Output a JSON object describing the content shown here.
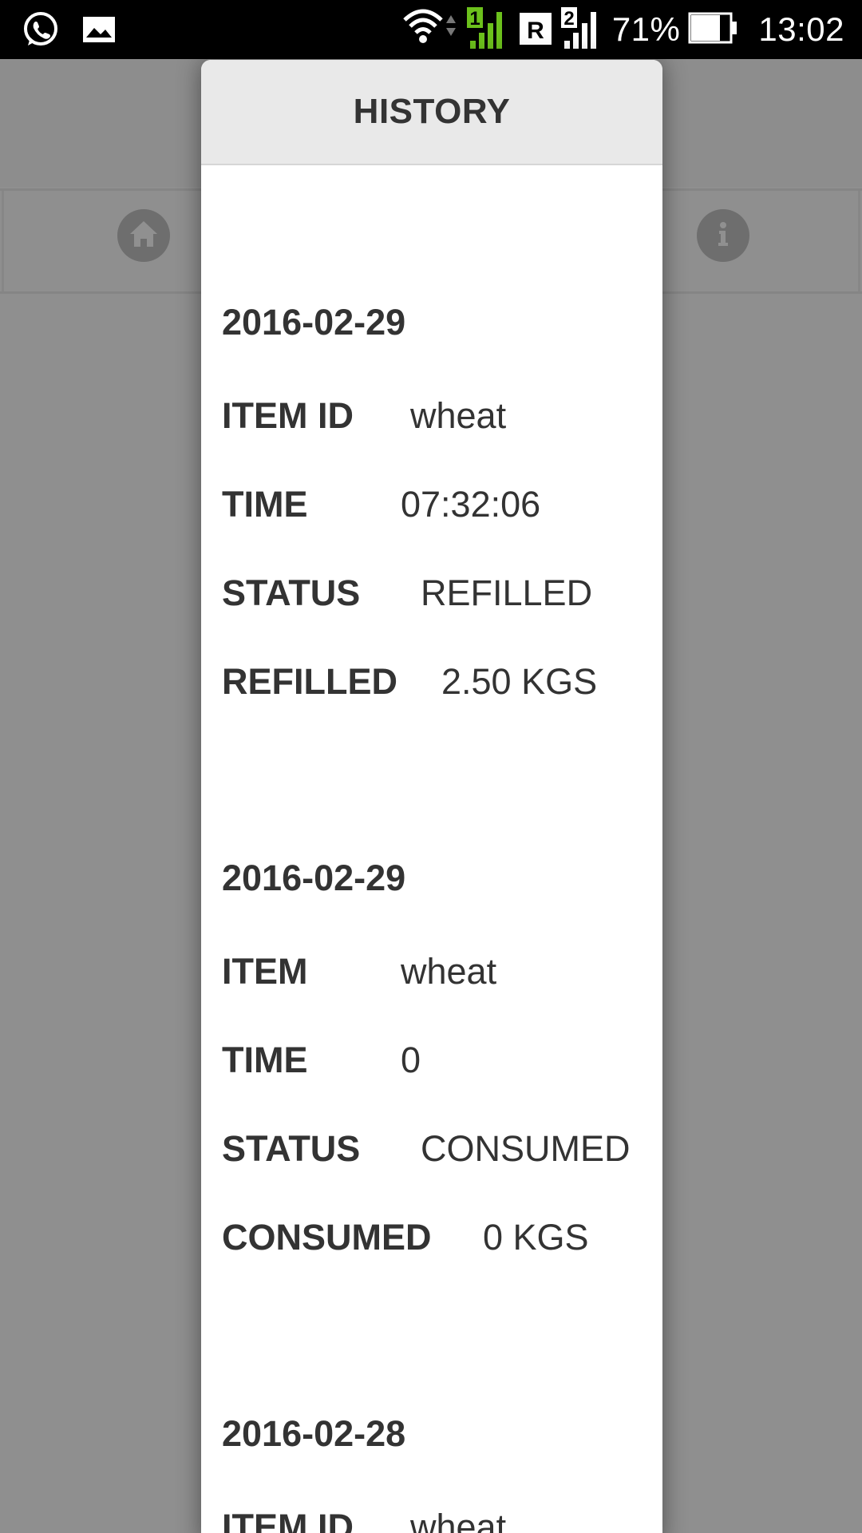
{
  "status_bar": {
    "battery_percent": "71%",
    "time": "13:02",
    "sim1_label": "1",
    "sim2_label": "2",
    "roaming_label": "R",
    "left_icons": [
      "whatsapp-icon",
      "image-icon"
    ],
    "right_icons": [
      "wifi-icon",
      "sim1-signal-icon",
      "roaming-icon",
      "sim2-signal-icon",
      "battery-icon"
    ]
  },
  "nav": {
    "icons": [
      "home-icon",
      "info-icon"
    ]
  },
  "popup": {
    "title": "HISTORY",
    "entries": [
      {
        "date": "2016-02-29",
        "rows": [
          {
            "label": "ITEM ID",
            "value": "wheat"
          },
          {
            "label": "TIME",
            "value": "07:32:06"
          },
          {
            "label": "STATUS",
            "value": "REFILLED"
          },
          {
            "label": "REFILLED",
            "value": "2.50 KGS"
          }
        ]
      },
      {
        "date": "2016-02-29",
        "rows": [
          {
            "label": "ITEM",
            "value": "wheat"
          },
          {
            "label": "TIME",
            "value": "0"
          },
          {
            "label": "STATUS",
            "value": "CONSUMED"
          },
          {
            "label": "CONSUMED",
            "value": "0 KGS"
          }
        ]
      },
      {
        "date": "2016-02-28",
        "rows": [
          {
            "label": "ITEM ID",
            "value": "wheat"
          }
        ]
      }
    ]
  }
}
